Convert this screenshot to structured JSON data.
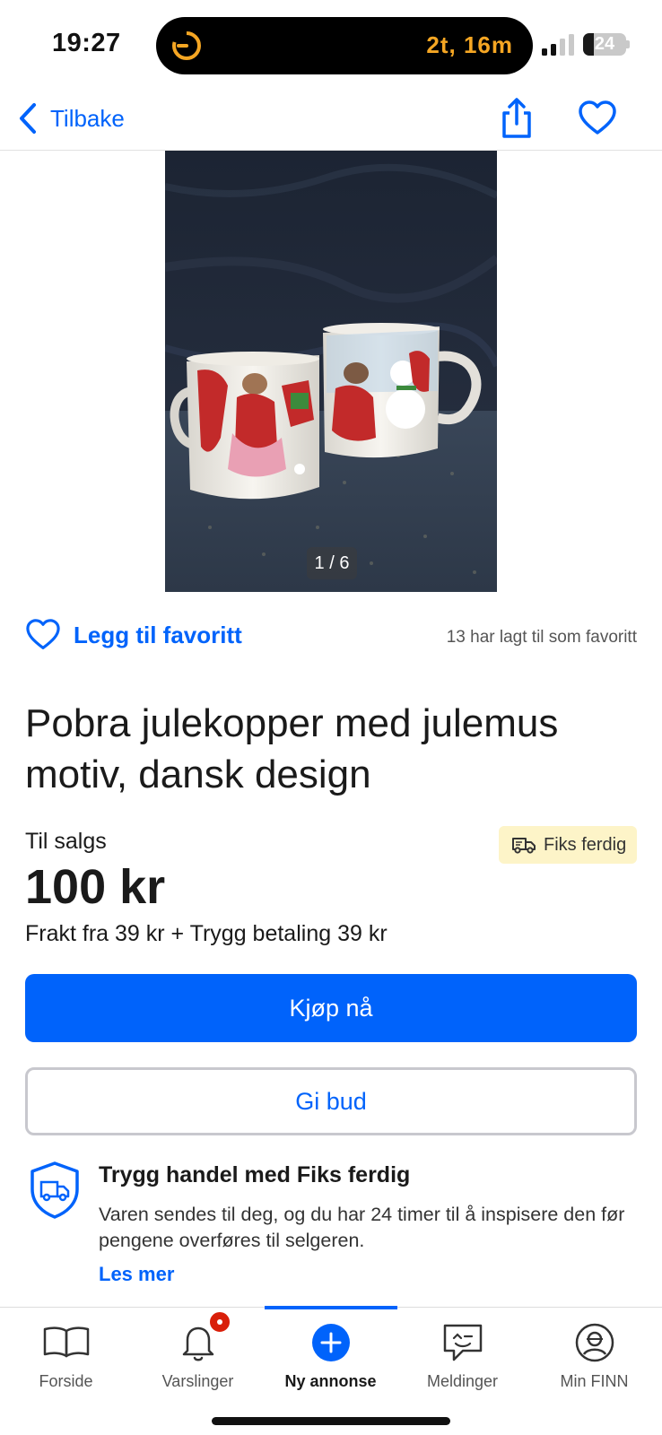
{
  "status_bar": {
    "time": "19:27",
    "activity_text": "2t, 16m",
    "battery_level": "24",
    "accent_color": "#f5a623"
  },
  "nav": {
    "back_label": "Tilbake",
    "share_icon": "share-icon",
    "favorite_icon": "heart-icon"
  },
  "gallery": {
    "counter": "1 / 6"
  },
  "favorite": {
    "label": "Legg til favoritt",
    "count_text": "13 har lagt til som favoritt"
  },
  "listing": {
    "title": "Pobra julekopper med julemus motiv, dansk design",
    "status": "Til salgs",
    "badge": "Fiks ferdig",
    "price": "100 kr",
    "shipping": "Frakt fra 39 kr + Trygg betaling 39 kr"
  },
  "actions": {
    "buy_label": "Kjøp nå",
    "bid_label": "Gi bud"
  },
  "trust": {
    "title": "Trygg handel med Fiks ferdig",
    "description": "Varen sendes til deg, og du har 24 timer til å inspisere den før pengene overføres til selgeren.",
    "link": "Les mer"
  },
  "tab_bar": {
    "tabs": [
      {
        "label": "Forside",
        "icon": "book-icon"
      },
      {
        "label": "Varslinger",
        "icon": "bell-icon"
      },
      {
        "label": "Ny annonse",
        "icon": "plus-circle-icon"
      },
      {
        "label": "Meldinger",
        "icon": "chat-icon"
      },
      {
        "label": "Min FINN",
        "icon": "profile-icon"
      }
    ],
    "active_index": 2
  },
  "colors": {
    "primary": "#0063fb",
    "badge_bg": "#fdf4c8",
    "notification": "#d91f0a"
  }
}
